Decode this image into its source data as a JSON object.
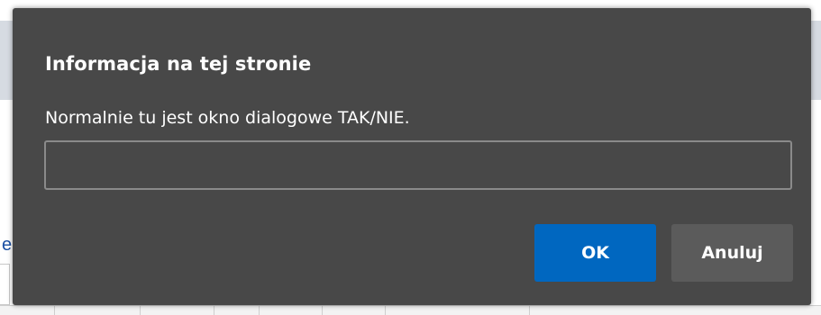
{
  "dialog": {
    "title": "Informacja na tej stronie",
    "message": "Normalnie tu jest okno dialogowe TAK/NIE.",
    "input_value": "",
    "ok_label": "OK",
    "cancel_label": "Anuluj"
  },
  "background": {
    "edge_letter": "e"
  },
  "colors": {
    "dialog_bg": "#484848",
    "primary_button": "#0067c0",
    "secondary_button": "#5b5b5b",
    "input_border": "#8a8a8a",
    "text": "#ffffff"
  }
}
